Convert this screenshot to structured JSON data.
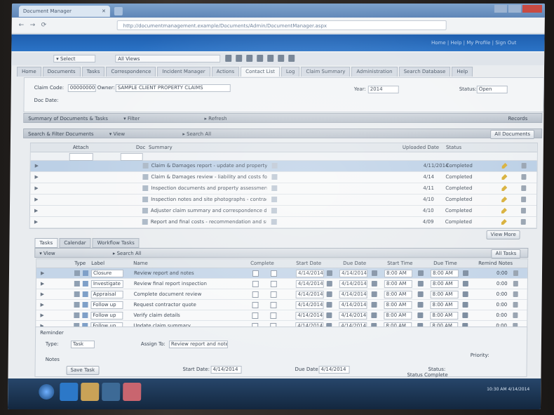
{
  "browser": {
    "tab_title": "Document Manager",
    "tab_close": "✕",
    "url": "http://documentmanagement.example/Documents/Admin/DocumentManager.aspx",
    "back": "←",
    "forward": "→",
    "refresh": "⟳"
  },
  "header": {
    "links": "Home | Help | My Profile | Sign Out"
  },
  "toolbar": {
    "entity_select": "▾ Select",
    "view_select": "All Views",
    "icons": [
      "save-icon",
      "edit-icon",
      "delete-icon",
      "print-icon",
      "export-icon",
      "refresh-icon",
      "settings-icon"
    ]
  },
  "module_tabs": [
    "Home",
    "Documents",
    "Tasks",
    "Correspondence",
    "Incident Manager",
    "Actions",
    "Contact List",
    "Log",
    "Claim Summary",
    "Administration",
    "Search Database",
    "Help"
  ],
  "active_module_tab_index": 6,
  "form": {
    "label1": "Claim Code:",
    "value1": "000000000",
    "label1b": "Owner:",
    "name_value": "SAMPLE CLIENT PROPERTY CLAIMS",
    "label2": "Year:",
    "value2": "2014",
    "label3": "Status:",
    "value3": "Open",
    "label4": "Doc Date:"
  },
  "section1": {
    "title": "Summary of Documents & Tasks",
    "filter": "▾ Filter",
    "right": "▸ Refresh",
    "count": "Records"
  },
  "section2": {
    "title": "Search & Filter Documents",
    "filter": "▾ View",
    "search": "▸ Search All",
    "right": "All Documents"
  },
  "doc_grid": {
    "columns": [
      "Attach",
      "Doc",
      "Summary",
      "Uploaded Date",
      "Status"
    ],
    "rows": [
      {
        "summary": "Claim & Damages report - update and property review",
        "date": "4/11/2014",
        "status": "Completed",
        "sel": true
      },
      {
        "summary": "Claim & Damages review - liability and costs follow-up",
        "date": "4/14",
        "status": "Completed",
        "sel": false
      },
      {
        "summary": "Inspection documents and property assessment notes",
        "date": "4/11",
        "status": "Completed",
        "sel": false
      },
      {
        "summary": "Inspection notes and site photographs - contractor",
        "date": "4/10",
        "status": "Completed",
        "sel": false
      },
      {
        "summary": "Adjuster claim summary and correspondence details",
        "date": "4/10",
        "status": "Completed",
        "sel": false
      },
      {
        "summary": "Report and final costs - recommendation and summary",
        "date": "4/09",
        "status": "Completed",
        "sel": false
      }
    ],
    "button": "View More"
  },
  "bottom_tabs": [
    "Tasks",
    "Calendar",
    "Workflow Tasks"
  ],
  "section3": {
    "filter": "▾ View",
    "search": "▸ Search All",
    "right": "All Tasks"
  },
  "task_grid": {
    "columns": [
      "Type",
      "Label",
      "Name",
      "Complete",
      "Start Date",
      "Due Date",
      "Start Time",
      "Due Time",
      "Remind Notes"
    ],
    "rows": [
      {
        "label": "Closure",
        "name": "Review report and notes",
        "sel": true
      },
      {
        "label": "Investigate",
        "name": "Review final report inspection",
        "sel": false
      },
      {
        "label": "Appraisal",
        "name": "Complete document review",
        "sel": false
      },
      {
        "label": "Follow up",
        "name": "Request contractor quote",
        "sel": false
      },
      {
        "label": "Follow up",
        "name": "Verify claim details",
        "sel": false
      },
      {
        "label": "Follow up",
        "name": "Update claim summary",
        "sel": false
      }
    ],
    "date_value": "4/14/2014",
    "time_value": "8:00 AM",
    "remind_value": "0:00"
  },
  "detail": {
    "label_type": "Type:",
    "label_task": "Task",
    "label_user": "Assign To:",
    "user_value": "Review report and notes",
    "label_start": "Start Date:",
    "label_due": "Due Date:",
    "label_status": "Status:",
    "label_priority": "Priority:",
    "start_value": "4/14/2014",
    "due_value": "4/14/2014",
    "label_notes": "Notes",
    "label_save": "Save Task",
    "label_status2": "Status Complete",
    "side_label": "Reminder"
  },
  "taskbar": {
    "clock": "10:30 AM\n4/14/2014"
  }
}
